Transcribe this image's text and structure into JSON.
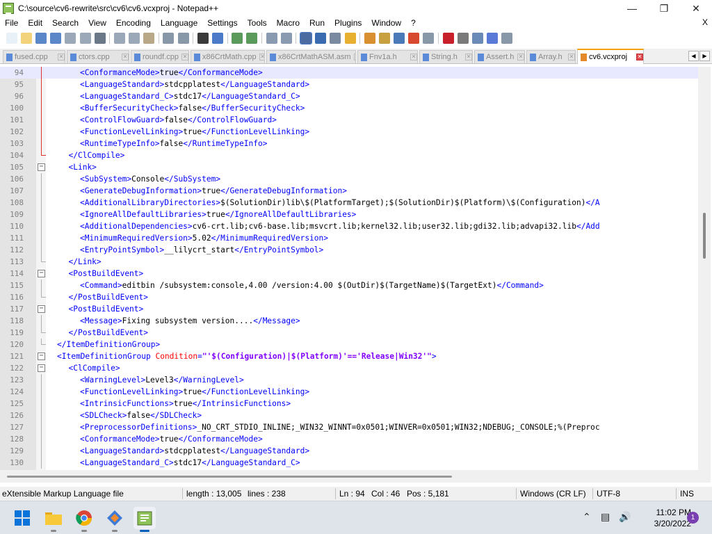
{
  "window": {
    "title": "C:\\source\\cv6-rewrite\\src\\cv6\\cv6.vcxproj - Notepad++"
  },
  "menu": {
    "items": [
      "File",
      "Edit",
      "Search",
      "View",
      "Encoding",
      "Language",
      "Settings",
      "Tools",
      "Macro",
      "Run",
      "Plugins",
      "Window",
      "?"
    ],
    "close_doc": "X"
  },
  "toolbar": {
    "icons": [
      "new-file-icon",
      "open-file-icon",
      "save-icon",
      "save-all-icon",
      "close-icon",
      "close-all-icon",
      "print-icon",
      "cut-icon",
      "copy-icon",
      "paste-icon",
      "undo-icon",
      "redo-icon",
      "find-icon",
      "replace-icon",
      "zoom-in-icon",
      "zoom-out-icon",
      "sync-vertical-icon",
      "sync-horizontal-icon",
      "word-wrap-icon",
      "show-all-characters-icon",
      "indent-guide-icon",
      "user-defined-language-icon",
      "doc-map-icon",
      "document-list-icon",
      "function-list-icon",
      "folder-as-workspace-icon",
      "monitoring-icon",
      "record-macro-icon",
      "stop-recording-icon",
      "playback-macro-icon",
      "run-macro-multiple-icon",
      "save-macro-icon"
    ]
  },
  "tabs": [
    {
      "label": "fused.cpp",
      "active": false
    },
    {
      "label": "ctors.cpp",
      "active": false
    },
    {
      "label": "roundf.cpp",
      "active": false
    },
    {
      "label": "x86CrtMath.cpp",
      "active": false
    },
    {
      "label": "x86CrtMathASM.asm",
      "active": false
    },
    {
      "label": "Fnv1a.h",
      "active": false
    },
    {
      "label": "String.h",
      "active": false
    },
    {
      "label": "Assert.h",
      "active": false
    },
    {
      "label": "Array.h",
      "active": false
    },
    {
      "label": "cv6.vcxproj",
      "active": true
    }
  ],
  "editor": {
    "current_line": "94",
    "lines": [
      {
        "n": "94",
        "parts": [
          [
            "tag",
            "<ConformanceMode>"
          ],
          [
            "txt",
            "true"
          ],
          [
            "tag",
            "</ConformanceMode>"
          ]
        ]
      },
      {
        "n": "95",
        "parts": [
          [
            "tag",
            "<LanguageStandard>"
          ],
          [
            "txt",
            "stdcpplatest"
          ],
          [
            "tag",
            "</LanguageStandard>"
          ]
        ]
      },
      {
        "n": "96",
        "parts": [
          [
            "tag",
            "<LanguageStandard_C>"
          ],
          [
            "txt",
            "stdc17"
          ],
          [
            "tag",
            "</LanguageStandard_C>"
          ]
        ]
      },
      {
        "n": "100",
        "parts": [
          [
            "tag",
            "<BufferSecurityCheck>"
          ],
          [
            "txt",
            "false"
          ],
          [
            "tag",
            "</BufferSecurityCheck>"
          ]
        ]
      },
      {
        "n": "101",
        "parts": [
          [
            "tag",
            "<ControlFlowGuard>"
          ],
          [
            "txt",
            "false"
          ],
          [
            "tag",
            "</ControlFlowGuard>"
          ]
        ]
      },
      {
        "n": "102",
        "parts": [
          [
            "tag",
            "<FunctionLevelLinking>"
          ],
          [
            "txt",
            "true"
          ],
          [
            "tag",
            "</FunctionLevelLinking>"
          ]
        ]
      },
      {
        "n": "103",
        "parts": [
          [
            "tag",
            "<RuntimeTypeInfo>"
          ],
          [
            "txt",
            "false"
          ],
          [
            "tag",
            "</RuntimeTypeInfo>"
          ]
        ]
      },
      {
        "n": "104",
        "parts": [
          [
            "tag",
            "</ClCompile>"
          ]
        ]
      },
      {
        "n": "105",
        "parts": [
          [
            "tag",
            "<Link>"
          ]
        ]
      },
      {
        "n": "106",
        "parts": [
          [
            "tag",
            "<SubSystem>"
          ],
          [
            "txt",
            "Console"
          ],
          [
            "tag",
            "</SubSystem>"
          ]
        ]
      },
      {
        "n": "107",
        "parts": [
          [
            "tag",
            "<GenerateDebugInformation>"
          ],
          [
            "txt",
            "true"
          ],
          [
            "tag",
            "</GenerateDebugInformation>"
          ]
        ]
      },
      {
        "n": "108",
        "parts": [
          [
            "tag",
            "<AdditionalLibraryDirectories>"
          ],
          [
            "txt",
            "$(SolutionDir)lib\\$(PlatformTarget);$(SolutionDir)$(Platform)\\$(Configuration)"
          ],
          [
            "tag",
            "</A"
          ]
        ]
      },
      {
        "n": "109",
        "parts": [
          [
            "tag",
            "<IgnoreAllDefaultLibraries>"
          ],
          [
            "txt",
            "true"
          ],
          [
            "tag",
            "</IgnoreAllDefaultLibraries>"
          ]
        ]
      },
      {
        "n": "110",
        "parts": [
          [
            "tag",
            "<AdditionalDependencies>"
          ],
          [
            "txt",
            "cv6-crt.lib;cv6-base.lib;msvcrt.lib;kernel32.lib;user32.lib;gdi32.lib;advapi32.lib"
          ],
          [
            "tag",
            "</Add"
          ]
        ]
      },
      {
        "n": "111",
        "parts": [
          [
            "tag",
            "<MinimumRequiredVersion>"
          ],
          [
            "txt",
            "5.02"
          ],
          [
            "tag",
            "</MinimumRequiredVersion>"
          ]
        ]
      },
      {
        "n": "112",
        "parts": [
          [
            "tag",
            "<EntryPointSymbol>"
          ],
          [
            "txt",
            "__lilycrt_start"
          ],
          [
            "tag",
            "</EntryPointSymbol>"
          ]
        ]
      },
      {
        "n": "113",
        "parts": [
          [
            "tag",
            "</Link>"
          ]
        ]
      },
      {
        "n": "114",
        "parts": [
          [
            "tag",
            "<PostBuildEvent>"
          ]
        ]
      },
      {
        "n": "115",
        "parts": [
          [
            "tag",
            "<Command>"
          ],
          [
            "txt",
            "editbin /subsystem:console,4.00 /version:4.00 $(OutDir)$(TargetName)$(TargetExt)"
          ],
          [
            "tag",
            "</Command>"
          ]
        ]
      },
      {
        "n": "116",
        "parts": [
          [
            "tag",
            "</PostBuildEvent>"
          ]
        ]
      },
      {
        "n": "117",
        "parts": [
          [
            "tag",
            "<PostBuildEvent>"
          ]
        ]
      },
      {
        "n": "118",
        "parts": [
          [
            "tag",
            "<Message>"
          ],
          [
            "txt",
            "Fixing subsystem version...."
          ],
          [
            "tag",
            "</Message>"
          ]
        ]
      },
      {
        "n": "119",
        "parts": [
          [
            "tag",
            "</PostBuildEvent>"
          ]
        ]
      },
      {
        "n": "120",
        "parts": [
          [
            "tag",
            "</ItemDefinitionGroup>"
          ]
        ]
      },
      {
        "n": "121",
        "parts": [
          [
            "tag",
            "<ItemDefinitionGroup "
          ],
          [
            "attr",
            "Condition"
          ],
          [
            "tag",
            "="
          ],
          [
            "val",
            "\"'$(Configuration)|$(Platform)'=='Release|Win32'\""
          ],
          [
            "tag",
            ">"
          ]
        ]
      },
      {
        "n": "122",
        "parts": [
          [
            "tag",
            "<ClCompile>"
          ]
        ]
      },
      {
        "n": "123",
        "parts": [
          [
            "tag",
            "<WarningLevel>"
          ],
          [
            "txt",
            "Level3"
          ],
          [
            "tag",
            "</WarningLevel>"
          ]
        ]
      },
      {
        "n": "124",
        "parts": [
          [
            "tag",
            "<FunctionLevelLinking>"
          ],
          [
            "txt",
            "true"
          ],
          [
            "tag",
            "</FunctionLevelLinking>"
          ]
        ]
      },
      {
        "n": "125",
        "parts": [
          [
            "tag",
            "<IntrinsicFunctions>"
          ],
          [
            "txt",
            "true"
          ],
          [
            "tag",
            "</IntrinsicFunctions>"
          ]
        ]
      },
      {
        "n": "126",
        "parts": [
          [
            "tag",
            "<SDLCheck>"
          ],
          [
            "txt",
            "false"
          ],
          [
            "tag",
            "</SDLCheck>"
          ]
        ]
      },
      {
        "n": "127",
        "parts": [
          [
            "tag",
            "<PreprocessorDefinitions>"
          ],
          [
            "txt",
            "_NO_CRT_STDIO_INLINE;_WIN32_WINNT=0x0501;WINVER=0x0501;WIN32;NDEBUG;_CONSOLE;%(Preproc"
          ]
        ]
      },
      {
        "n": "128",
        "parts": [
          [
            "tag",
            "<ConformanceMode>"
          ],
          [
            "txt",
            "true"
          ],
          [
            "tag",
            "</ConformanceMode>"
          ]
        ]
      },
      {
        "n": "129",
        "parts": [
          [
            "tag",
            "<LanguageStandard>"
          ],
          [
            "txt",
            "stdcpplatest"
          ],
          [
            "tag",
            "</LanguageStandard>"
          ]
        ]
      },
      {
        "n": "130",
        "parts": [
          [
            "tag",
            "<LanguageStandard_C>"
          ],
          [
            "txt",
            "stdc17"
          ],
          [
            "tag",
            "</LanguageStandard_C>"
          ]
        ]
      }
    ]
  },
  "statusbar": {
    "file_type": "eXtensible Markup Language file",
    "length": "length : 13,005",
    "lines": "lines : 238",
    "ln": "Ln : 94",
    "col": "Col : 46",
    "pos": "Pos : 5,181",
    "eol": "Windows (CR LF)",
    "encoding": "UTF-8",
    "mode": "INS"
  },
  "taskbar": {
    "time": "11:02 PM",
    "date": "3/20/2022",
    "notifications": "1"
  },
  "colors": {
    "tag": "#0000ff",
    "attr": "#ff0000",
    "value": "#8000ff",
    "current_line": "#e8e8ff",
    "active_tab_accent": "#f4a000"
  }
}
